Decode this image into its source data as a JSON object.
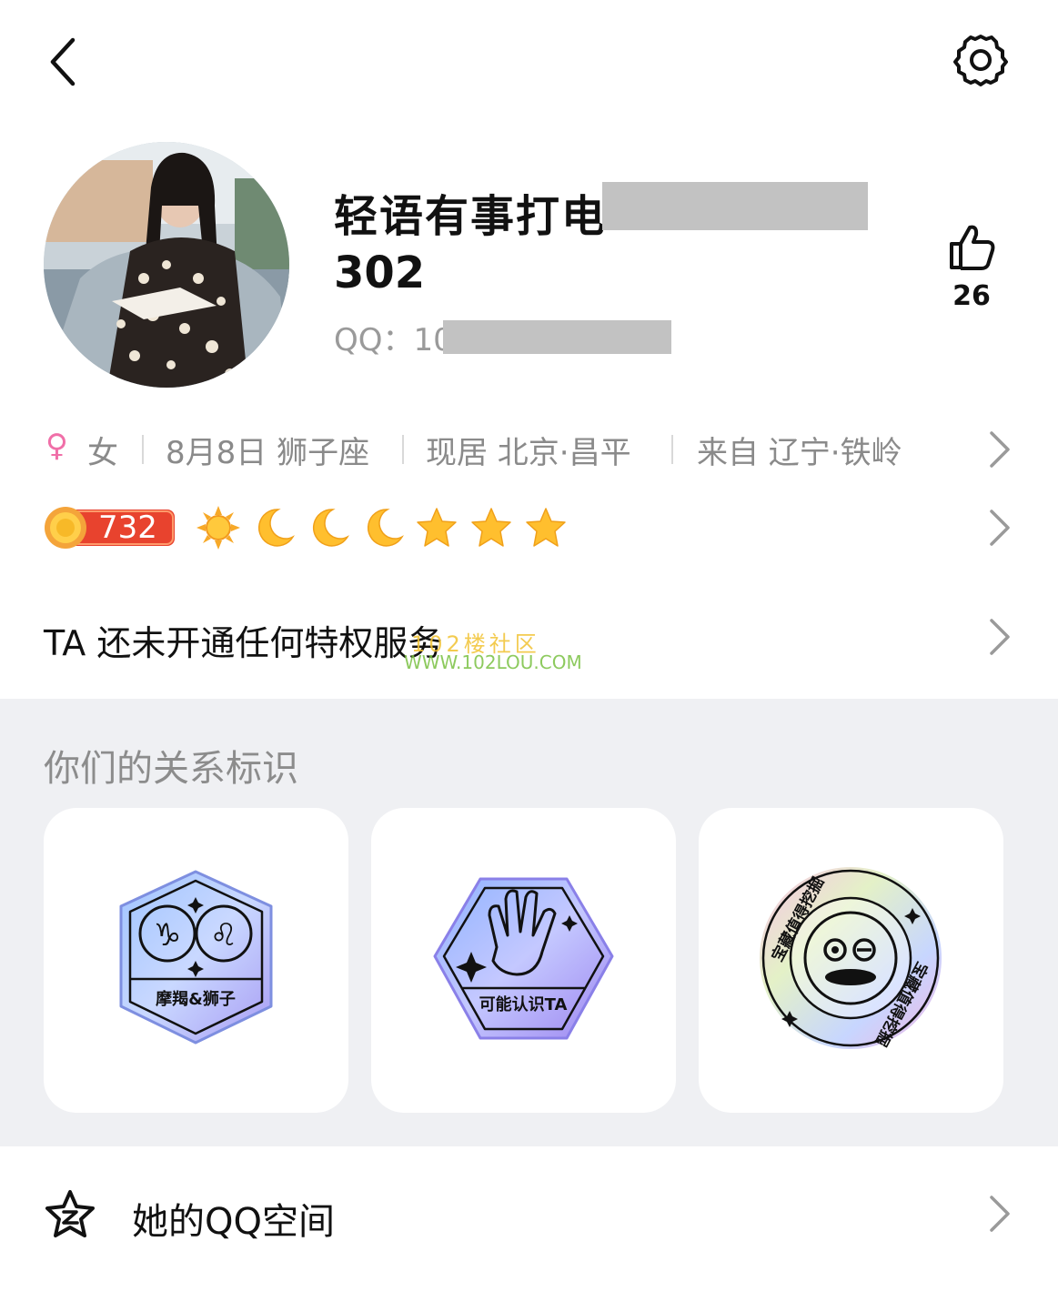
{
  "profile": {
    "nickname_prefix": "轻语有事打电",
    "nickname_line2": "302",
    "qq_label": "QQ：",
    "qq_prefix": "10",
    "likes": "26"
  },
  "info": {
    "gender_symbol": "♀",
    "gender": "女",
    "birthday": "8月8日 狮子座",
    "location": "现居 北京·昌平",
    "hometown": "来自 辽宁·铁岭"
  },
  "level": {
    "value": "732",
    "icons": [
      "sun-icon",
      "moon-icon",
      "moon-icon",
      "moon-icon",
      "star-icon",
      "star-icon",
      "star-icon"
    ]
  },
  "privilege": {
    "text": "TA 还未开通任何特权服务"
  },
  "watermark": {
    "line1": "102楼社区",
    "line2": "WWW.102LOU.COM"
  },
  "relationship": {
    "title": "你们的关系标识",
    "cards": [
      {
        "label": "摩羯&狮子"
      },
      {
        "label": "可能认识TA"
      },
      {
        "label": "宝藏值得挖掘"
      }
    ]
  },
  "zone": {
    "label": "她的QQ空间"
  },
  "colors": {
    "gender": "#f06fa8",
    "level_badge": "#e8432e",
    "star": "#f7b928",
    "section_bg": "#eff0f3"
  }
}
